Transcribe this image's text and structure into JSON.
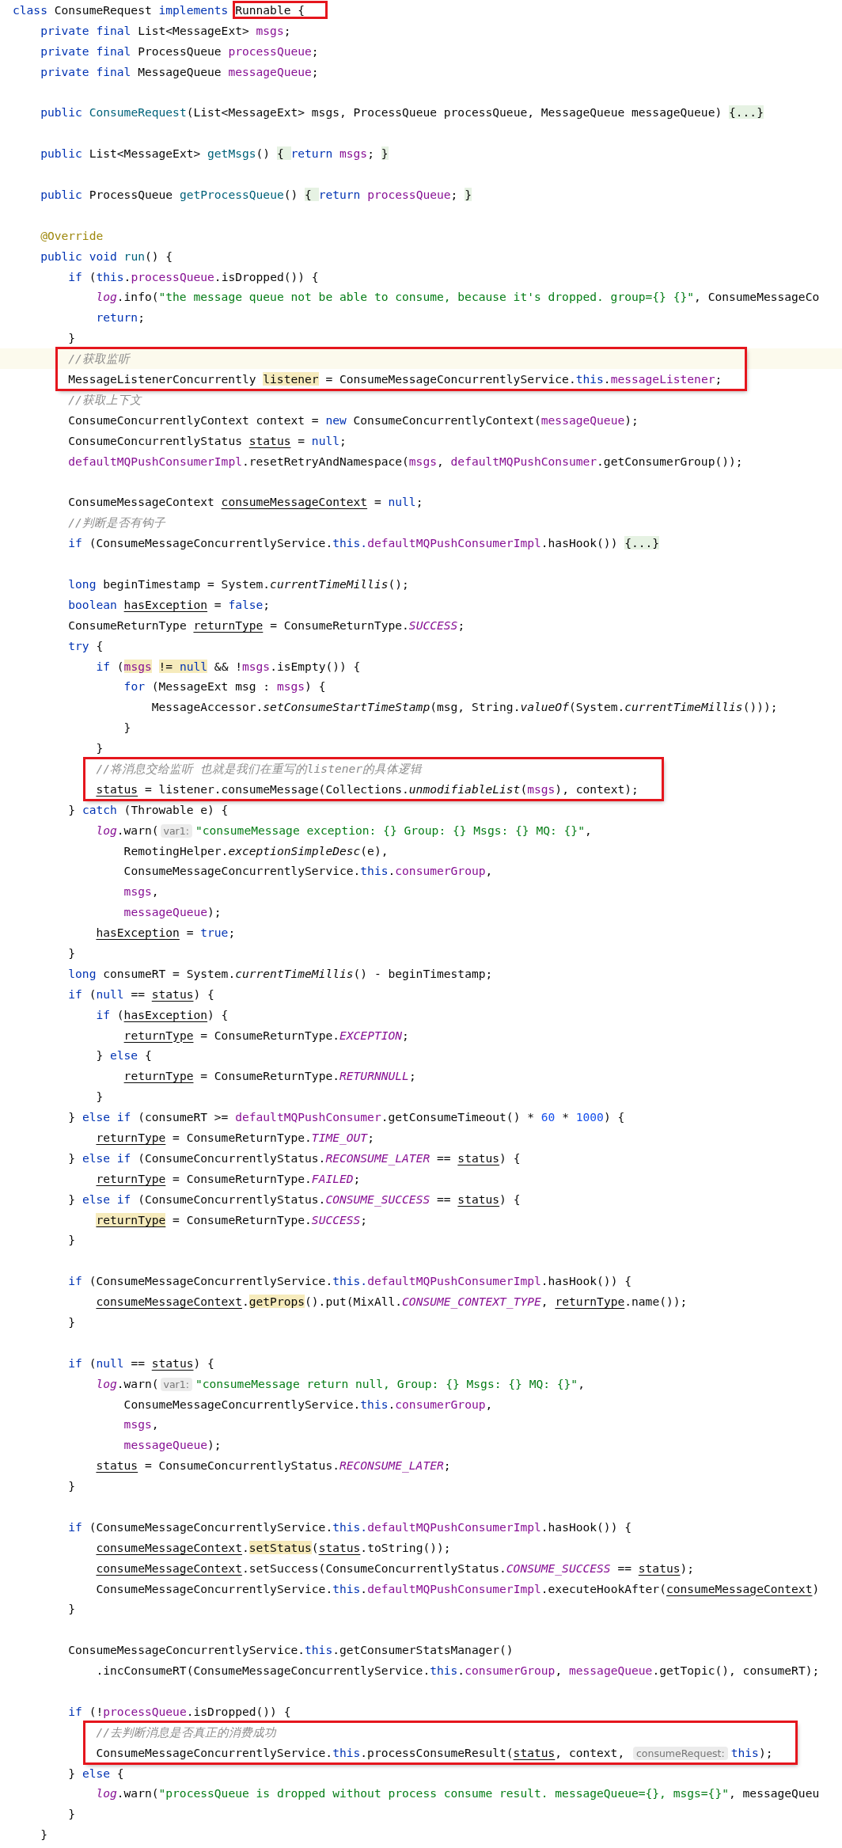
{
  "blocks": [
    {
      "boxed": false,
      "lines": [
        {
          "current": false,
          "segments": [
            {
              "kind": "kw",
              "text": "class "
            },
            {
              "kind": "plain",
              "text": "ConsumeRequest "
            },
            {
              "kind": "kw",
              "text": "implements "
            },
            {
              "kind": "boxed",
              "text": "Runnable {"
            }
          ]
        },
        {
          "current": false,
          "segments": [
            {
              "kind": "kw",
              "text": "    private final "
            },
            {
              "kind": "plain",
              "text": "List<MessageExt> "
            },
            {
              "kind": "field",
              "text": "msgs"
            },
            {
              "kind": "plain",
              "text": ";"
            }
          ]
        },
        {
          "current": false,
          "segments": [
            {
              "kind": "kw",
              "text": "    private final "
            },
            {
              "kind": "plain",
              "text": "ProcessQueue "
            },
            {
              "kind": "field",
              "text": "processQueue"
            },
            {
              "kind": "plain",
              "text": ";"
            }
          ]
        },
        {
          "current": false,
          "segments": [
            {
              "kind": "kw",
              "text": "    private final "
            },
            {
              "kind": "plain",
              "text": "MessageQueue "
            },
            {
              "kind": "field",
              "text": "messageQueue"
            },
            {
              "kind": "plain",
              "text": ";"
            }
          ]
        },
        {
          "current": false
        },
        {
          "current": false,
          "segments": [
            {
              "kind": "kw",
              "text": "    public "
            },
            {
              "kind": "method",
              "text": "ConsumeRequest"
            },
            {
              "kind": "plain",
              "text": "(List<MessageExt> msgs, ProcessQueue processQueue, MessageQueue messageQueue) "
            },
            {
              "kind": "fold",
              "text": "{...}"
            }
          ]
        },
        {
          "current": false
        },
        {
          "current": false,
          "segments": [
            {
              "kind": "kw",
              "text": "    public "
            },
            {
              "kind": "plain",
              "text": "List<MessageExt> "
            },
            {
              "kind": "method",
              "text": "getMsgs"
            },
            {
              "kind": "plain",
              "text": "() "
            },
            {
              "kind": "fold",
              "text": "{ "
            },
            {
              "kind": "kw",
              "text": "return "
            },
            {
              "kind": "field",
              "text": "msgs"
            },
            {
              "kind": "plain",
              "text": "; "
            },
            {
              "kind": "fold",
              "text": "}"
            }
          ]
        },
        {
          "current": false
        },
        {
          "current": false,
          "segments": [
            {
              "kind": "kw",
              "text": "    public "
            },
            {
              "kind": "plain",
              "text": "ProcessQueue "
            },
            {
              "kind": "method",
              "text": "getProcessQueue"
            },
            {
              "kind": "plain",
              "text": "() "
            },
            {
              "kind": "fold",
              "text": "{ "
            },
            {
              "kind": "kw",
              "text": "return "
            },
            {
              "kind": "field",
              "text": "processQueue"
            },
            {
              "kind": "plain",
              "text": "; "
            },
            {
              "kind": "fold",
              "text": "}"
            }
          ]
        },
        {
          "current": false
        },
        {
          "current": false,
          "segments": [
            {
              "kind": "ann",
              "text": "    @Override"
            }
          ]
        },
        {
          "current": false,
          "segments": [
            {
              "kind": "kw",
              "text": "    public void "
            },
            {
              "kind": "method",
              "text": "run"
            },
            {
              "kind": "plain",
              "text": "() {"
            }
          ]
        },
        {
          "current": false,
          "segments": [
            {
              "kind": "kw",
              "text": "        if "
            },
            {
              "kind": "plain",
              "text": "("
            },
            {
              "kind": "kw",
              "text": "this"
            },
            {
              "kind": "plain",
              "text": "."
            },
            {
              "kind": "field",
              "text": "processQueue"
            },
            {
              "kind": "plain",
              "text": ".isDropped()) {"
            }
          ]
        },
        {
          "current": false,
          "segments": [
            {
              "kind": "sfield",
              "text": "            log"
            },
            {
              "kind": "plain",
              "text": ".info("
            },
            {
              "kind": "str",
              "text": "\"the message queue not be able to consume, because it's dropped. group={} {}\""
            },
            {
              "kind": "plain",
              "text": ", ConsumeMessageCo"
            }
          ]
        },
        {
          "current": false,
          "segments": [
            {
              "kind": "kw",
              "text": "            return"
            },
            {
              "kind": "plain",
              "text": ";"
            }
          ]
        },
        {
          "current": false,
          "segments": [
            {
              "kind": "plain",
              "text": "        }"
            }
          ]
        }
      ]
    },
    {
      "boxed": true,
      "lines": [
        {
          "current": true,
          "segments": [
            {
              "kind": "cmt",
              "text": "        //获取监听"
            }
          ]
        },
        {
          "current": false,
          "segments": [
            {
              "kind": "plain",
              "text": "        MessageListenerConcurrently "
            },
            {
              "kind": "usage",
              "text": "listener"
            },
            {
              "kind": "plain",
              "text": " = ConsumeMessageConcurrentlyService."
            },
            {
              "kind": "kw",
              "text": "this"
            },
            {
              "kind": "plain",
              "text": "."
            },
            {
              "kind": "field",
              "text": "messageListener"
            },
            {
              "kind": "plain",
              "text": ";"
            }
          ]
        }
      ]
    },
    {
      "boxed": false,
      "lines": [
        {
          "current": false,
          "segments": [
            {
              "kind": "cmt",
              "text": "        //获取上下文"
            }
          ]
        },
        {
          "current": false,
          "segments": [
            {
              "kind": "plain",
              "text": "        ConsumeConcurrentlyContext context = "
            },
            {
              "kind": "kw",
              "text": "new "
            },
            {
              "kind": "plain",
              "text": "ConsumeConcurrentlyContext("
            },
            {
              "kind": "field",
              "text": "messageQueue"
            },
            {
              "kind": "plain",
              "text": ");"
            }
          ]
        },
        {
          "current": false,
          "segments": [
            {
              "kind": "plain",
              "text": "        ConsumeConcurrentlyStatus "
            },
            {
              "kind": "var",
              "text": "status"
            },
            {
              "kind": "plain",
              "text": " = "
            },
            {
              "kind": "kw",
              "text": "null"
            },
            {
              "kind": "plain",
              "text": ";"
            }
          ]
        },
        {
          "current": false,
          "segments": [
            {
              "kind": "field",
              "text": "        defaultMQPushConsumerImpl"
            },
            {
              "kind": "plain",
              "text": ".resetRetryAndNamespace("
            },
            {
              "kind": "field",
              "text": "msgs"
            },
            {
              "kind": "plain",
              "text": ", "
            },
            {
              "kind": "field",
              "text": "defaultMQPushConsumer"
            },
            {
              "kind": "plain",
              "text": ".getConsumerGroup());"
            }
          ]
        },
        {
          "current": false
        },
        {
          "current": false,
          "segments": [
            {
              "kind": "plain",
              "text": "        ConsumeMessageContext "
            },
            {
              "kind": "var",
              "text": "consumeMessageContext"
            },
            {
              "kind": "plain",
              "text": " = "
            },
            {
              "kind": "kw",
              "text": "null"
            },
            {
              "kind": "plain",
              "text": ";"
            }
          ]
        },
        {
          "current": false,
          "segments": [
            {
              "kind": "cmt",
              "text": "        //判断是否有钩子"
            }
          ]
        },
        {
          "current": false,
          "segments": [
            {
              "kind": "kw",
              "text": "        if "
            },
            {
              "kind": "plain",
              "text": "(ConsumeMessageConcurrentlyService."
            },
            {
              "kind": "kw",
              "text": "this."
            },
            {
              "kind": "field",
              "text": "defaultMQPushConsumerImpl"
            },
            {
              "kind": "plain",
              "text": ".hasHook()) "
            },
            {
              "kind": "fold",
              "text": "{...}"
            }
          ]
        },
        {
          "current": false
        },
        {
          "current": false,
          "segments": [
            {
              "kind": "kw",
              "text": "        long "
            },
            {
              "kind": "plain",
              "text": "beginTimestamp = System."
            },
            {
              "kind": "scall",
              "text": "currentTimeMillis"
            },
            {
              "kind": "plain",
              "text": "();"
            }
          ]
        },
        {
          "current": false,
          "segments": [
            {
              "kind": "kw",
              "text": "        boolean "
            },
            {
              "kind": "var",
              "text": "hasException"
            },
            {
              "kind": "plain",
              "text": " = "
            },
            {
              "kind": "kw",
              "text": "false"
            },
            {
              "kind": "plain",
              "text": ";"
            }
          ]
        },
        {
          "current": false,
          "segments": [
            {
              "kind": "plain",
              "text": "        ConsumeReturnType "
            },
            {
              "kind": "var",
              "text": "returnType"
            },
            {
              "kind": "plain",
              "text": " = ConsumeReturnType."
            },
            {
              "kind": "sfield",
              "text": "SUCCESS"
            },
            {
              "kind": "plain",
              "text": ";"
            }
          ]
        },
        {
          "current": false,
          "segments": [
            {
              "kind": "kw",
              "text": "        try "
            },
            {
              "kind": "plain",
              "text": "{"
            }
          ]
        },
        {
          "current": false,
          "segments": [
            {
              "kind": "kw",
              "text": "            if "
            },
            {
              "kind": "plain",
              "text": "("
            },
            {
              "kind": "usage-field",
              "text": "msgs"
            },
            {
              "kind": "usage",
              "text": " != "
            },
            {
              "kind": "usage-kw",
              "text": "null"
            },
            {
              "kind": "plain",
              "text": " && !"
            },
            {
              "kind": "field",
              "text": "msgs"
            },
            {
              "kind": "plain",
              "text": ".isEmpty()) {"
            }
          ]
        },
        {
          "current": false,
          "segments": [
            {
              "kind": "kw",
              "text": "                for "
            },
            {
              "kind": "plain",
              "text": "(MessageExt msg : "
            },
            {
              "kind": "field",
              "text": "msgs"
            },
            {
              "kind": "plain",
              "text": ") {"
            }
          ]
        },
        {
          "current": false,
          "segments": [
            {
              "kind": "plain",
              "text": "                    MessageAccessor."
            },
            {
              "kind": "scall",
              "text": "setConsumeStartTimeStamp"
            },
            {
              "kind": "plain",
              "text": "(msg, String."
            },
            {
              "kind": "scall",
              "text": "valueOf"
            },
            {
              "kind": "plain",
              "text": "(System."
            },
            {
              "kind": "scall",
              "text": "currentTimeMillis"
            },
            {
              "kind": "plain",
              "text": "()));"
            }
          ]
        },
        {
          "current": false,
          "segments": [
            {
              "kind": "plain",
              "text": "                }"
            }
          ]
        },
        {
          "current": false,
          "segments": [
            {
              "kind": "plain",
              "text": "            }"
            }
          ]
        }
      ]
    },
    {
      "boxed": true,
      "lines": [
        {
          "current": false,
          "segments": [
            {
              "kind": "cmt",
              "text": "            //将消息交给监听 也就是我们在重写的listener的具体逻辑"
            }
          ]
        },
        {
          "current": false,
          "segments": [
            {
              "kind": "var",
              "text": "            status"
            },
            {
              "kind": "plain",
              "text": " = listener.consumeMessage(Collections."
            },
            {
              "kind": "scall",
              "text": "unmodifiableList"
            },
            {
              "kind": "plain",
              "text": "("
            },
            {
              "kind": "field",
              "text": "msgs"
            },
            {
              "kind": "plain",
              "text": "), context);"
            }
          ]
        }
      ]
    },
    {
      "boxed": false,
      "lines": [
        {
          "current": false,
          "segments": [
            {
              "kind": "plain",
              "text": "        } "
            },
            {
              "kind": "kw",
              "text": "catch "
            },
            {
              "kind": "plain",
              "text": "(Throwable e) {"
            }
          ]
        },
        {
          "current": false,
          "segments": [
            {
              "kind": "sfield",
              "text": "            log"
            },
            {
              "kind": "plain",
              "text": ".warn("
            },
            {
              "kind": "hint",
              "text": "var1:"
            },
            {
              "kind": "str",
              "text": "\"consumeMessage exception: {} Group: {} Msgs: {} MQ: {}\""
            },
            {
              "kind": "plain",
              "text": ","
            }
          ]
        },
        {
          "current": false,
          "segments": [
            {
              "kind": "plain",
              "text": "                RemotingHelper."
            },
            {
              "kind": "scall",
              "text": "exceptionSimpleDesc"
            },
            {
              "kind": "plain",
              "text": "(e),"
            }
          ]
        },
        {
          "current": false,
          "segments": [
            {
              "kind": "plain",
              "text": "                ConsumeMessageConcurrentlyService."
            },
            {
              "kind": "kw",
              "text": "this"
            },
            {
              "kind": "plain",
              "text": "."
            },
            {
              "kind": "field",
              "text": "consumerGroup"
            },
            {
              "kind": "plain",
              "text": ","
            }
          ]
        },
        {
          "current": false,
          "segments": [
            {
              "kind": "field",
              "text": "                msgs"
            },
            {
              "kind": "plain",
              "text": ","
            }
          ]
        },
        {
          "current": false,
          "segments": [
            {
              "kind": "field",
              "text": "                messageQueue"
            },
            {
              "kind": "plain",
              "text": ");"
            }
          ]
        },
        {
          "current": false,
          "segments": [
            {
              "kind": "var",
              "text": "            hasException"
            },
            {
              "kind": "plain",
              "text": " = "
            },
            {
              "kind": "kw",
              "text": "true"
            },
            {
              "kind": "plain",
              "text": ";"
            }
          ]
        },
        {
          "current": false,
          "segments": [
            {
              "kind": "plain",
              "text": "        }"
            }
          ]
        },
        {
          "current": false,
          "segments": [
            {
              "kind": "kw",
              "text": "        long "
            },
            {
              "kind": "plain",
              "text": "consumeRT = System."
            },
            {
              "kind": "scall",
              "text": "currentTimeMillis"
            },
            {
              "kind": "plain",
              "text": "() - beginTimestamp;"
            }
          ]
        },
        {
          "current": false,
          "segments": [
            {
              "kind": "kw",
              "text": "        if "
            },
            {
              "kind": "plain",
              "text": "("
            },
            {
              "kind": "kw",
              "text": "null "
            },
            {
              "kind": "plain",
              "text": "== "
            },
            {
              "kind": "var",
              "text": "status"
            },
            {
              "kind": "plain",
              "text": ") {"
            }
          ]
        },
        {
          "current": false,
          "segments": [
            {
              "kind": "kw",
              "text": "            if "
            },
            {
              "kind": "plain",
              "text": "("
            },
            {
              "kind": "var",
              "text": "hasException"
            },
            {
              "kind": "plain",
              "text": ") {"
            }
          ]
        },
        {
          "current": false,
          "segments": [
            {
              "kind": "var",
              "text": "                returnType"
            },
            {
              "kind": "plain",
              "text": " = ConsumeReturnType."
            },
            {
              "kind": "sfield",
              "text": "EXCEPTION"
            },
            {
              "kind": "plain",
              "text": ";"
            }
          ]
        },
        {
          "current": false,
          "segments": [
            {
              "kind": "plain",
              "text": "            } "
            },
            {
              "kind": "kw",
              "text": "else "
            },
            {
              "kind": "plain",
              "text": "{"
            }
          ]
        },
        {
          "current": false,
          "segments": [
            {
              "kind": "var",
              "text": "                returnType"
            },
            {
              "kind": "plain",
              "text": " = ConsumeReturnType."
            },
            {
              "kind": "sfield",
              "text": "RETURNNULL"
            },
            {
              "kind": "plain",
              "text": ";"
            }
          ]
        },
        {
          "current": false,
          "segments": [
            {
              "kind": "plain",
              "text": "            }"
            }
          ]
        },
        {
          "current": false,
          "segments": [
            {
              "kind": "plain",
              "text": "        } "
            },
            {
              "kind": "kw",
              "text": "else if "
            },
            {
              "kind": "plain",
              "text": "(consumeRT >= "
            },
            {
              "kind": "field",
              "text": "defaultMQPushConsumer"
            },
            {
              "kind": "plain",
              "text": ".getConsumeTimeout() * "
            },
            {
              "kind": "num",
              "text": "60"
            },
            {
              "kind": "plain",
              "text": " * "
            },
            {
              "kind": "num",
              "text": "1000"
            },
            {
              "kind": "plain",
              "text": ") {"
            }
          ]
        },
        {
          "current": false,
          "segments": [
            {
              "kind": "var",
              "text": "            returnType"
            },
            {
              "kind": "plain",
              "text": " = ConsumeReturnType."
            },
            {
              "kind": "sfield",
              "text": "TIME_OUT"
            },
            {
              "kind": "plain",
              "text": ";"
            }
          ]
        },
        {
          "current": false,
          "segments": [
            {
              "kind": "plain",
              "text": "        } "
            },
            {
              "kind": "kw",
              "text": "else if "
            },
            {
              "kind": "plain",
              "text": "(ConsumeConcurrentlyStatus."
            },
            {
              "kind": "sfield",
              "text": "RECONSUME_LATER"
            },
            {
              "kind": "plain",
              "text": " == "
            },
            {
              "kind": "var",
              "text": "status"
            },
            {
              "kind": "plain",
              "text": ") {"
            }
          ]
        },
        {
          "current": false,
          "segments": [
            {
              "kind": "var",
              "text": "            returnType"
            },
            {
              "kind": "plain",
              "text": " = ConsumeReturnType."
            },
            {
              "kind": "sfield",
              "text": "FAILED"
            },
            {
              "kind": "plain",
              "text": ";"
            }
          ]
        },
        {
          "current": false,
          "segments": [
            {
              "kind": "plain",
              "text": "        } "
            },
            {
              "kind": "kw",
              "text": "else if "
            },
            {
              "kind": "plain",
              "text": "(ConsumeConcurrentlyStatus."
            },
            {
              "kind": "sfield",
              "text": "CONSUME_SUCCESS"
            },
            {
              "kind": "plain",
              "text": " == "
            },
            {
              "kind": "var",
              "text": "status"
            },
            {
              "kind": "plain",
              "text": ") {"
            }
          ]
        },
        {
          "current": false,
          "segments": [
            {
              "kind": "usage-var",
              "text": "            returnType"
            },
            {
              "kind": "plain",
              "text": " = ConsumeReturnType."
            },
            {
              "kind": "sfield",
              "text": "SUCCESS"
            },
            {
              "kind": "plain",
              "text": ";"
            }
          ]
        },
        {
          "current": false,
          "segments": [
            {
              "kind": "plain",
              "text": "        }"
            }
          ]
        },
        {
          "current": false
        },
        {
          "current": false,
          "segments": [
            {
              "kind": "kw",
              "text": "        if "
            },
            {
              "kind": "plain",
              "text": "(ConsumeMessageConcurrentlyService."
            },
            {
              "kind": "kw",
              "text": "this."
            },
            {
              "kind": "field",
              "text": "defaultMQPushConsumerImpl"
            },
            {
              "kind": "plain",
              "text": ".hasHook()) {"
            }
          ]
        },
        {
          "current": false,
          "segments": [
            {
              "kind": "var",
              "text": "            consumeMessageContext"
            },
            {
              "kind": "plain",
              "text": "."
            },
            {
              "kind": "usage",
              "text": "getProps"
            },
            {
              "kind": "plain",
              "text": "().put(MixAll."
            },
            {
              "kind": "sfield",
              "text": "CONSUME_CONTEXT_TYPE"
            },
            {
              "kind": "plain",
              "text": ", "
            },
            {
              "kind": "var",
              "text": "returnType"
            },
            {
              "kind": "plain",
              "text": ".name());"
            }
          ]
        },
        {
          "current": false,
          "segments": [
            {
              "kind": "plain",
              "text": "        }"
            }
          ]
        },
        {
          "current": false
        },
        {
          "current": false,
          "segments": [
            {
              "kind": "kw",
              "text": "        if "
            },
            {
              "kind": "plain",
              "text": "("
            },
            {
              "kind": "kw",
              "text": "null "
            },
            {
              "kind": "plain",
              "text": "== "
            },
            {
              "kind": "var",
              "text": "status"
            },
            {
              "kind": "plain",
              "text": ") {"
            }
          ]
        },
        {
          "current": false,
          "segments": [
            {
              "kind": "sfield",
              "text": "            log"
            },
            {
              "kind": "plain",
              "text": ".warn("
            },
            {
              "kind": "hint",
              "text": "var1:"
            },
            {
              "kind": "str",
              "text": "\"consumeMessage return null, Group: {} Msgs: {} MQ: {}\""
            },
            {
              "kind": "plain",
              "text": ","
            }
          ]
        },
        {
          "current": false,
          "segments": [
            {
              "kind": "plain",
              "text": "                ConsumeMessageConcurrentlyService."
            },
            {
              "kind": "kw",
              "text": "this"
            },
            {
              "kind": "plain",
              "text": "."
            },
            {
              "kind": "field",
              "text": "consumerGroup"
            },
            {
              "kind": "plain",
              "text": ","
            }
          ]
        },
        {
          "current": false,
          "segments": [
            {
              "kind": "field",
              "text": "                msgs"
            },
            {
              "kind": "plain",
              "text": ","
            }
          ]
        },
        {
          "current": false,
          "segments": [
            {
              "kind": "field",
              "text": "                messageQueue"
            },
            {
              "kind": "plain",
              "text": ");"
            }
          ]
        },
        {
          "current": false,
          "segments": [
            {
              "kind": "var",
              "text": "            status"
            },
            {
              "kind": "plain",
              "text": " = ConsumeConcurrentlyStatus."
            },
            {
              "kind": "sfield",
              "text": "RECONSUME_LATER"
            },
            {
              "kind": "plain",
              "text": ";"
            }
          ]
        },
        {
          "current": false,
          "segments": [
            {
              "kind": "plain",
              "text": "        }"
            }
          ]
        },
        {
          "current": false
        },
        {
          "current": false,
          "segments": [
            {
              "kind": "kw",
              "text": "        if "
            },
            {
              "kind": "plain",
              "text": "(ConsumeMessageConcurrentlyService."
            },
            {
              "kind": "kw",
              "text": "this."
            },
            {
              "kind": "field",
              "text": "defaultMQPushConsumerImpl"
            },
            {
              "kind": "plain",
              "text": ".hasHook()) {"
            }
          ]
        },
        {
          "current": false,
          "segments": [
            {
              "kind": "var",
              "text": "            consumeMessageContext"
            },
            {
              "kind": "plain",
              "text": "."
            },
            {
              "kind": "usage",
              "text": "setStatus"
            },
            {
              "kind": "plain",
              "text": "("
            },
            {
              "kind": "var",
              "text": "status"
            },
            {
              "kind": "plain",
              "text": ".toString());"
            }
          ]
        },
        {
          "current": false,
          "segments": [
            {
              "kind": "var",
              "text": "            consumeMessageContext"
            },
            {
              "kind": "plain",
              "text": ".setSuccess(ConsumeConcurrentlyStatus."
            },
            {
              "kind": "sfield",
              "text": "CONSUME_SUCCESS"
            },
            {
              "kind": "plain",
              "text": " == "
            },
            {
              "kind": "var",
              "text": "status"
            },
            {
              "kind": "plain",
              "text": ");"
            }
          ]
        },
        {
          "current": false,
          "segments": [
            {
              "kind": "plain",
              "text": "            ConsumeMessageConcurrentlyService."
            },
            {
              "kind": "kw",
              "text": "this"
            },
            {
              "kind": "plain",
              "text": "."
            },
            {
              "kind": "field",
              "text": "defaultMQPushConsumerImpl"
            },
            {
              "kind": "plain",
              "text": ".executeHookAfter("
            },
            {
              "kind": "var",
              "text": "consumeMessageContext"
            },
            {
              "kind": "plain",
              "text": ")"
            }
          ]
        },
        {
          "current": false,
          "segments": [
            {
              "kind": "plain",
              "text": "        }"
            }
          ]
        },
        {
          "current": false
        },
        {
          "current": false,
          "segments": [
            {
              "kind": "plain",
              "text": "        ConsumeMessageConcurrentlyService."
            },
            {
              "kind": "kw",
              "text": "this"
            },
            {
              "kind": "plain",
              "text": ".getConsumerStatsManager()"
            }
          ]
        },
        {
          "current": false,
          "segments": [
            {
              "kind": "plain",
              "text": "            .incConsumeRT(ConsumeMessageConcurrentlyService."
            },
            {
              "kind": "kw",
              "text": "this"
            },
            {
              "kind": "plain",
              "text": "."
            },
            {
              "kind": "field",
              "text": "consumerGroup"
            },
            {
              "kind": "plain",
              "text": ", "
            },
            {
              "kind": "field",
              "text": "messageQueue"
            },
            {
              "kind": "plain",
              "text": ".getTopic(), consumeRT);"
            }
          ]
        },
        {
          "current": false
        },
        {
          "current": false,
          "segments": [
            {
              "kind": "kw",
              "text": "        if "
            },
            {
              "kind": "plain",
              "text": "(!"
            },
            {
              "kind": "field",
              "text": "processQueue"
            },
            {
              "kind": "plain",
              "text": ".isDropped()) {"
            }
          ]
        }
      ]
    },
    {
      "boxed": true,
      "lines": [
        {
          "current": false,
          "segments": [
            {
              "kind": "cmt",
              "text": "            //去判断消息是否真正的消费成功"
            }
          ]
        },
        {
          "current": false,
          "segments": [
            {
              "kind": "plain",
              "text": "            ConsumeMessageConcurrentlyService."
            },
            {
              "kind": "kw",
              "text": "this"
            },
            {
              "kind": "plain",
              "text": ".processConsumeResult("
            },
            {
              "kind": "var",
              "text": "status"
            },
            {
              "kind": "plain",
              "text": ", context, "
            },
            {
              "kind": "hint",
              "text": "consumeRequest:"
            },
            {
              "kind": "kw",
              "text": "this"
            },
            {
              "kind": "plain",
              "text": ");"
            }
          ]
        }
      ]
    },
    {
      "boxed": false,
      "lines": [
        {
          "current": false,
          "segments": [
            {
              "kind": "plain",
              "text": "        } "
            },
            {
              "kind": "kw",
              "text": "else "
            },
            {
              "kind": "plain",
              "text": "{"
            }
          ]
        },
        {
          "current": false,
          "segments": [
            {
              "kind": "sfield",
              "text": "            log"
            },
            {
              "kind": "plain",
              "text": ".warn("
            },
            {
              "kind": "str",
              "text": "\"processQueue is dropped without process consume result. messageQueue={}, msgs={}\""
            },
            {
              "kind": "plain",
              "text": ", messageQueu"
            }
          ]
        },
        {
          "current": false,
          "segments": [
            {
              "kind": "plain",
              "text": "        }"
            }
          ]
        },
        {
          "current": false,
          "segments": [
            {
              "kind": "plain",
              "text": "    }"
            }
          ]
        }
      ]
    }
  ]
}
